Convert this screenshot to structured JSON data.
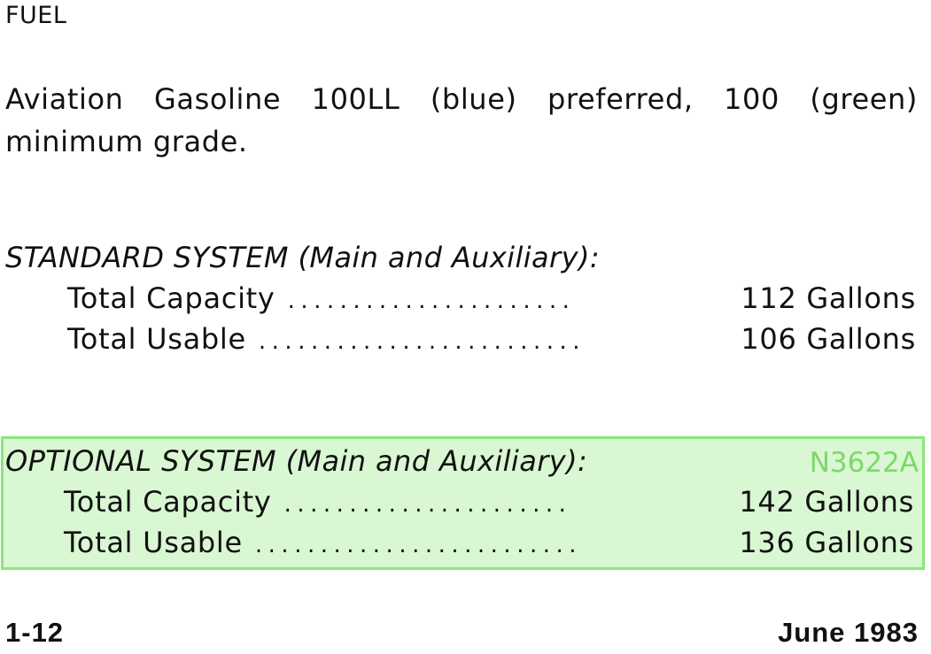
{
  "heading": "FUEL",
  "paragraph": "Aviation Gasoline 100LL (blue) preferred, 100 (green) minimum grade.",
  "standard": {
    "title": "STANDARD SYSTEM (Main and Auxiliary):",
    "rows": [
      {
        "label": "Total Capacity",
        "dots": "......................",
        "value": "112 Gallons"
      },
      {
        "label": "Total Usable",
        "dots": ".........................",
        "value": "106 Gallons"
      }
    ]
  },
  "optional": {
    "title": "OPTIONAL SYSTEM (Main and Auxiliary):",
    "tag": "N3622A",
    "highlight_color": "#d9f7d2",
    "highlight_border": "#8be77a",
    "rows": [
      {
        "label": "Total Capacity",
        "dots": "......................",
        "value": "142 Gallons"
      },
      {
        "label": "Total Usable",
        "dots": ".........................",
        "value": "136 Gallons"
      }
    ]
  },
  "footer": {
    "page_number": "1-12",
    "date": "June 1983"
  }
}
